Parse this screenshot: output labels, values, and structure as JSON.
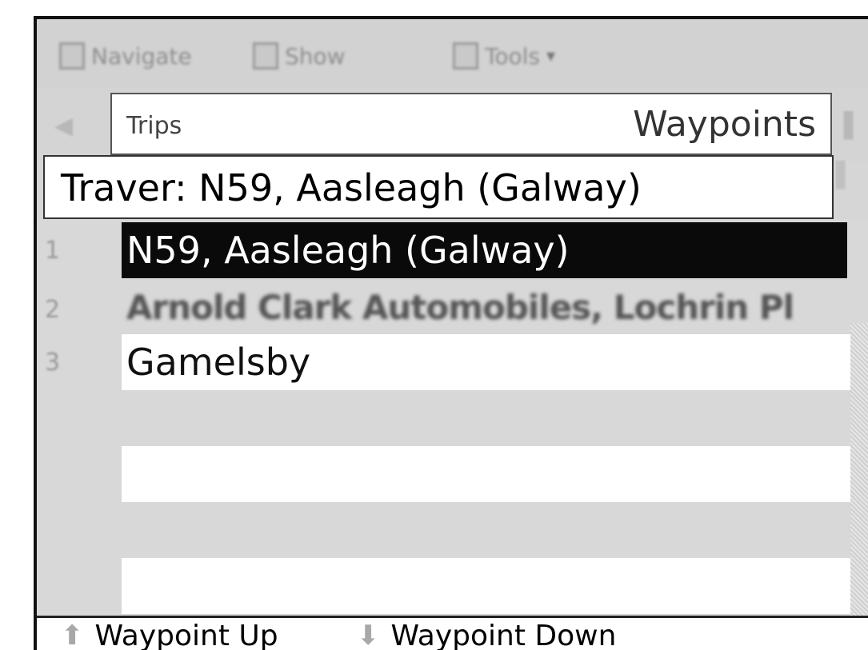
{
  "toolbar": {
    "items": [
      {
        "label": "Navigate",
        "icon": "navigate-icon"
      },
      {
        "label": "Show",
        "icon": "show-icon"
      },
      {
        "label": "Tools",
        "icon": "tools-icon"
      }
    ]
  },
  "tabs": {
    "trips": "Trips",
    "waypoints": "Waypoints"
  },
  "title": "Traver: N59, Aasleagh (Galway)",
  "waypoints": [
    {
      "num": "1",
      "label": "N59, Aasleagh (Galway)"
    },
    {
      "num": "2",
      "label": "Arnold Clark Automobiles, Lochrin Pl"
    },
    {
      "num": "3",
      "label": "Gamelsby"
    }
  ],
  "bottom": {
    "up": "Waypoint Up",
    "down": "Waypoint Down"
  }
}
